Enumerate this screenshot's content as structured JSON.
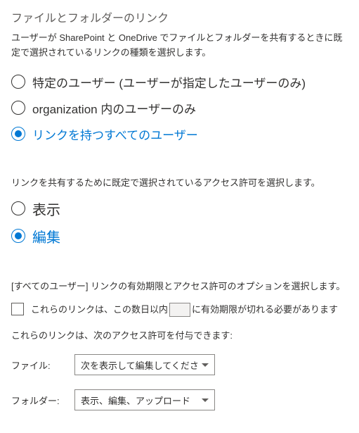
{
  "header": {
    "title": "ファイルとフォルダーのリンク",
    "description": "ユーザーが SharePoint と OneDrive でファイルとフォルダーを共有するときに既定で選択されているリンクの種類を選択します。"
  },
  "link_type": {
    "options": [
      {
        "label": "特定のユーザー (ユーザーが指定したユーザーのみ)",
        "selected": false
      },
      {
        "label": "organization 内のユーザーのみ",
        "selected": false
      },
      {
        "label": "リンクを持つすべてのユーザー",
        "selected": true
      }
    ]
  },
  "permission_desc": "リンクを共有するために既定で選択されているアクセス許可を選択します。",
  "permission": {
    "options": [
      {
        "label": "表示",
        "selected": false
      },
      {
        "label": "編集",
        "selected": true
      }
    ]
  },
  "anyone_desc": "[すべてのユーザー] リンクの有効期限とアクセス許可のオプションを選択します。",
  "expiration": {
    "label_before": "これらのリンクは、この数日以内",
    "label_after": "に有効期限が切れる必要があります",
    "checked": false
  },
  "perm_grant_desc": "これらのリンクは、次のアクセス許可を付与できます:",
  "file_row": {
    "label": "ファイル:",
    "value": "次を表示して編集してください:"
  },
  "folder_row": {
    "label": "フォルダー:",
    "value": "表示、編集、アップロード"
  }
}
